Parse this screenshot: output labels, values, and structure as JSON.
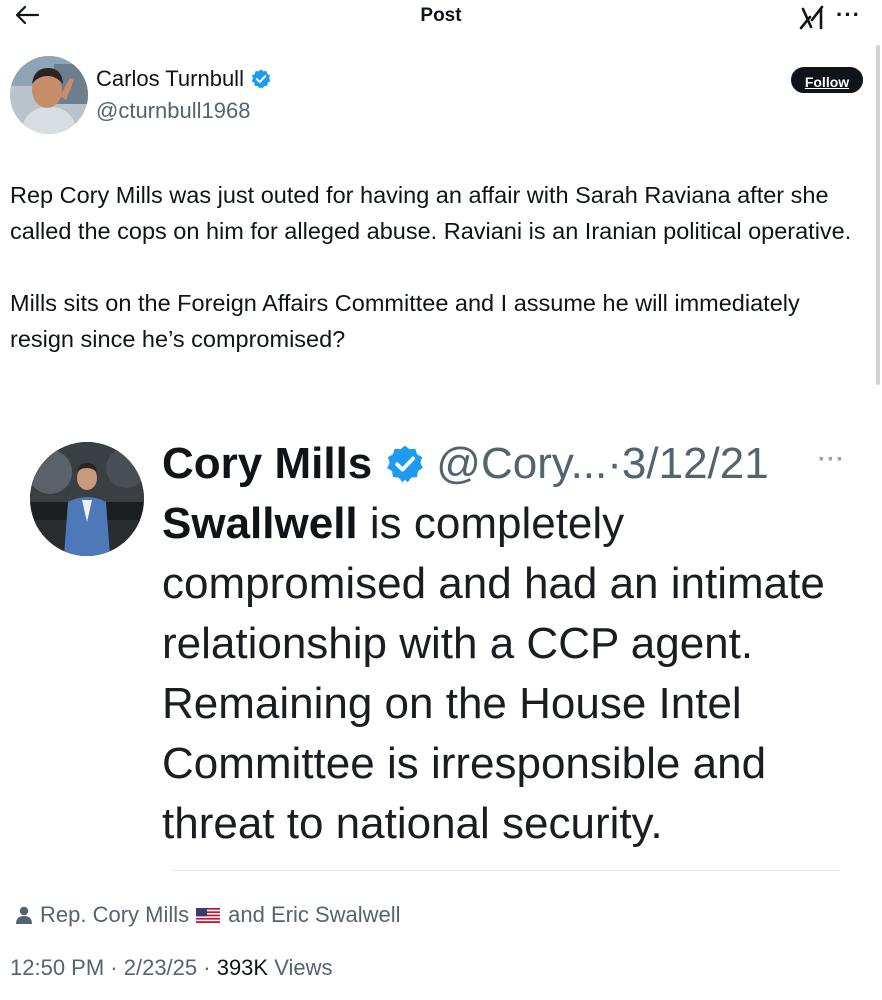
{
  "topbar": {
    "title": "Post",
    "back_icon": "arrow-left-icon",
    "grok_icon": "grok-icon",
    "more_icon": "more-horizontal-icon",
    "more_label": "···"
  },
  "author": {
    "name": "Carlos Turnbull",
    "handle": "@cturnbull1968",
    "verified": true,
    "follow_label": "Follow"
  },
  "post": {
    "paragraph_1": "Rep Cory Mills was just outed for having an affair with Sarah Raviana after she called the cops on him for alleged abuse. Raviani is an Iranian political operative.",
    "paragraph_2": "Mills sits on the Foreign Affairs Committee and I assume he will immediately resign since he’s compromised?"
  },
  "embedded": {
    "name": "Cory Mills",
    "handle": "@Cory...",
    "separator": " · ",
    "date": "3/12/21",
    "more_label": "···",
    "text_bold": "Swallwell",
    "text_rest": " is completely compromised and had an intimate relationship with a CCP agent. Remaining on the House Intel Committee is irresponsible and threat to national security."
  },
  "people": {
    "icon": "person-icon",
    "person_1": "Rep. Cory Mills",
    "flag": "us-flag-icon",
    "joiner": "and Eric Swalwell"
  },
  "meta": {
    "time": "12:50 PM",
    "dot": " · ",
    "date": "2/23/25",
    "views_count": "393K",
    "views_label": " Views"
  },
  "colors": {
    "text": "#0f1419",
    "secondary": "#536471",
    "verified": "#1d9bf0"
  }
}
